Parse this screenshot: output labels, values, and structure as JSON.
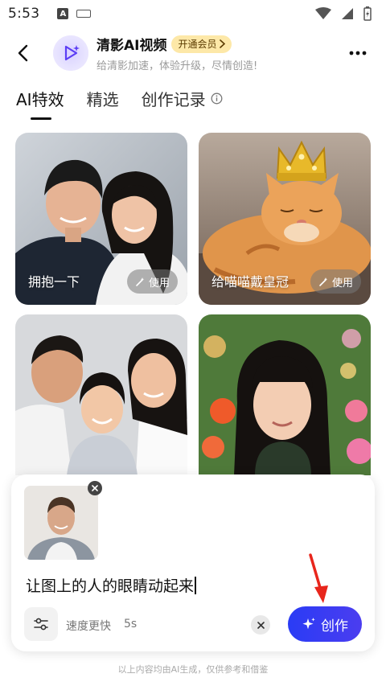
{
  "status_bar": {
    "time": "5:53",
    "icons": [
      "notification-a-icon",
      "keyboard-icon",
      "wifi-icon",
      "signal-icon",
      "battery-icon"
    ]
  },
  "header": {
    "app_name": "清影AI视频",
    "vip_label": "开通会员",
    "subtitle": "给清影加速，体验升级，尽情创造!"
  },
  "tabs": [
    {
      "label": "AI特效",
      "active": true
    },
    {
      "label": "精选",
      "active": false
    },
    {
      "label": "创作记录",
      "active": false
    }
  ],
  "cards": [
    {
      "label": "拥抱一下",
      "use_label": "使用"
    },
    {
      "label": "给喵喵戴皇冠",
      "use_label": "使用"
    },
    {
      "label": "",
      "use_label": ""
    },
    {
      "label": "",
      "use_label": ""
    }
  ],
  "composer": {
    "prompt": "让图上的人的眼睛动起来",
    "speed_label": "速度更快",
    "duration": "5s",
    "create_label": "创作"
  },
  "footer_note": "以上内容均由AI生成，仅供参考和借鉴",
  "colors": {
    "accent": "#3340f2",
    "vip_bg": "#fde8a8",
    "annotation_arrow": "#e8261c"
  }
}
